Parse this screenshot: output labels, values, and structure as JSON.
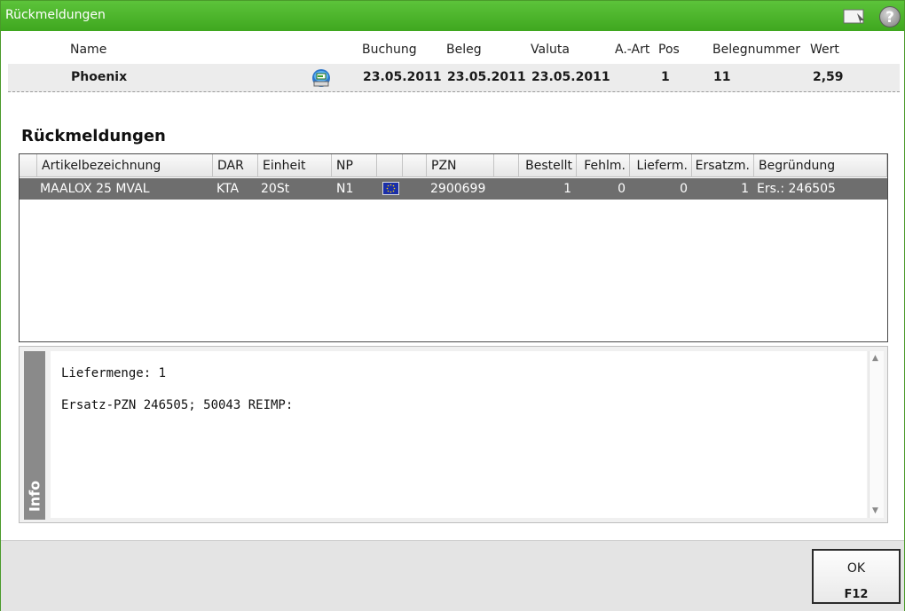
{
  "window": {
    "title": "Rückmeldungen"
  },
  "header": {
    "labels": {
      "name": "Name",
      "buchung": "Buchung",
      "beleg": "Beleg",
      "valuta": "Valuta",
      "a_art": "A.-Art",
      "pos": "Pos",
      "belegnummer": "Belegnummer",
      "wert": "Wert"
    },
    "row": {
      "name": "Phoenix",
      "buchung": "23.05.2011",
      "beleg": "23.05.2011",
      "valuta": "23.05.2011",
      "pos": "1",
      "belegnummer": "11",
      "wert": "2,59"
    }
  },
  "section": {
    "title": "Rückmeldungen"
  },
  "grid": {
    "columns": {
      "artikelbezeichnung": "Artikelbezeichnung",
      "dar": "DAR",
      "einheit": "Einheit",
      "np": "NP",
      "pzn": "PZN",
      "bestellt": "Bestellt",
      "fehlm": "Fehlm.",
      "lieferm": "Lieferm.",
      "ersatzm": "Ersatzm.",
      "begruendung": "Begründung"
    },
    "rows": [
      {
        "artikelbezeichnung": "MAALOX 25 MVAL",
        "dar": "KTA",
        "einheit": "20St",
        "np": "N1",
        "flag": "eu-flag-icon",
        "pzn": "2900699",
        "bestellt": "1",
        "fehlm": "0",
        "lieferm": "0",
        "ersatzm": "1",
        "begruendung": "Ers.: 246505"
      }
    ]
  },
  "info": {
    "tab_label": "Info",
    "lines": [
      "Liefermenge: 1",
      "Ersatz-PZN 246505; 50043 REIMP:"
    ]
  },
  "footer": {
    "ok_label": "OK",
    "ok_key": "F12"
  },
  "colors": {
    "titlebar": "#4cb52c",
    "selected_row": "#6e6e6e",
    "info_tab": "#8a8a8a"
  }
}
